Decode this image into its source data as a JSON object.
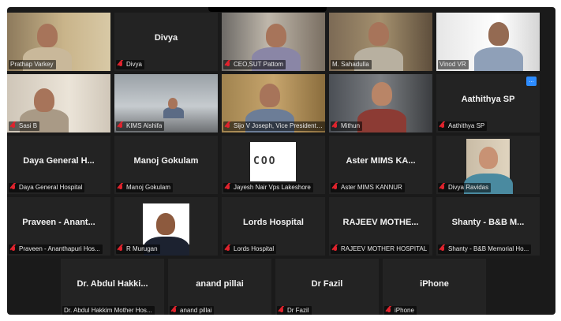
{
  "tiles": [
    {
      "row": 0,
      "col": 0,
      "kind": "video",
      "scene": "office-warm",
      "label": "Prathap Varkey",
      "active": false
    },
    {
      "row": 0,
      "col": 1,
      "kind": "name",
      "center": "Divya",
      "label": "Divya"
    },
    {
      "row": 0,
      "col": 2,
      "kind": "video",
      "scene": "office-people",
      "label": "CEO,SUT Pattom"
    },
    {
      "row": 0,
      "col": 3,
      "kind": "video",
      "scene": "office-warm2",
      "label": "M. Sahadulla",
      "active": true
    },
    {
      "row": 0,
      "col": 4,
      "kind": "video",
      "scene": "bright",
      "label": "Vinod VR"
    },
    {
      "row": 1,
      "col": 0,
      "kind": "video",
      "scene": "pale",
      "label": "Sasi B"
    },
    {
      "row": 1,
      "col": 1,
      "kind": "video",
      "scene": "room",
      "label": "KIMS Alshifa"
    },
    {
      "row": 1,
      "col": 2,
      "kind": "video",
      "scene": "office-brown",
      "label": "Sijo V Joseph, Vice President, ..."
    },
    {
      "row": 1,
      "col": 3,
      "kind": "video",
      "scene": "dark-room",
      "label": "Mithun"
    },
    {
      "row": 1,
      "col": 4,
      "kind": "name",
      "center": "Aathithya SP",
      "label": "Aathithya SP",
      "badge": true
    },
    {
      "row": 2,
      "col": 0,
      "kind": "name",
      "center": "Daya General H...",
      "label": "Daya General Hospital"
    },
    {
      "row": 2,
      "col": 1,
      "kind": "name",
      "center": "Manoj Gokulam",
      "label": "Manoj Gokulam"
    },
    {
      "row": 2,
      "col": 2,
      "kind": "coo",
      "center": "COO",
      "label": "Jayesh Nair Vps Lakeshore"
    },
    {
      "row": 2,
      "col": 3,
      "kind": "name",
      "center": "Aster MIMS KA...",
      "label": "Aster MIMS KANNUR"
    },
    {
      "row": 2,
      "col": 4,
      "kind": "photo",
      "scene": "woman",
      "label": "Divya Ravidas"
    },
    {
      "row": 3,
      "col": 0,
      "kind": "name",
      "center": "Praveen - Anant...",
      "label": "Praveen - Ananthapuri Hos..."
    },
    {
      "row": 3,
      "col": 1,
      "kind": "photo",
      "scene": "man-portrait",
      "label": "R Murugan"
    },
    {
      "row": 3,
      "col": 2,
      "kind": "name",
      "center": "Lords Hospital",
      "label": "Lords Hospital"
    },
    {
      "row": 3,
      "col": 3,
      "kind": "name",
      "center": "RAJEEV MOTHE...",
      "label": "RAJEEV MOTHER HOSPITAL"
    },
    {
      "row": 3,
      "col": 4,
      "kind": "name",
      "center": "Shanty - B&B M...",
      "label": "Shanty - B&B Memorial Ho..."
    },
    {
      "row": 4,
      "col": 0.5,
      "kind": "name",
      "center": "Dr. Abdul Hakki...",
      "label": "Dr. Abdul Hakkim Mother Hos..."
    },
    {
      "row": 4,
      "col": 1.5,
      "kind": "name",
      "center": "anand pillai",
      "label": "anand pillai"
    },
    {
      "row": 4,
      "col": 2.5,
      "kind": "name",
      "center": "Dr Fazil",
      "label": "Dr Fazil"
    },
    {
      "row": 4,
      "col": 3.5,
      "kind": "name",
      "center": "iPhone",
      "label": "iPhone"
    }
  ],
  "colors": {
    "active_outline": "#b7d63a",
    "mute_red": "#e0232d",
    "badge_blue": "#2d8cff"
  }
}
